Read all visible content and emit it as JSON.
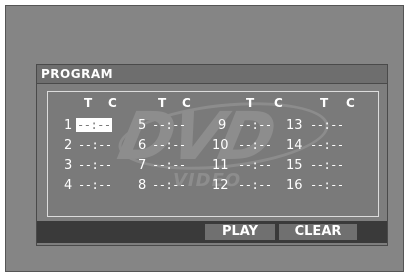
{
  "panel": {
    "title": "PROGRAM"
  },
  "headers": [
    "T",
    "C",
    "T",
    "C",
    "T",
    "C",
    "T",
    "C"
  ],
  "slots": [
    {
      "num": "1",
      "value": "--:--",
      "selected": true
    },
    {
      "num": "2",
      "value": "--:--"
    },
    {
      "num": "3",
      "value": "--:--"
    },
    {
      "num": "4",
      "value": "--:--"
    },
    {
      "num": "5",
      "value": "--:--"
    },
    {
      "num": "6",
      "value": "--:--"
    },
    {
      "num": "7",
      "value": "--:--"
    },
    {
      "num": "8",
      "value": "--:--"
    },
    {
      "num": "9",
      "value": "--:--"
    },
    {
      "num": "10",
      "value": "--:--"
    },
    {
      "num": "11",
      "value": "--:--"
    },
    {
      "num": "12",
      "value": "--:--"
    },
    {
      "num": "13",
      "value": "--:--"
    },
    {
      "num": "14",
      "value": "--:--"
    },
    {
      "num": "15",
      "value": "--:--"
    },
    {
      "num": "16",
      "value": "--:--"
    }
  ],
  "buttons": {
    "play": "PLAY",
    "clear": "CLEAR"
  },
  "watermark": {
    "main": "DVD",
    "sub": "VIDEO"
  }
}
